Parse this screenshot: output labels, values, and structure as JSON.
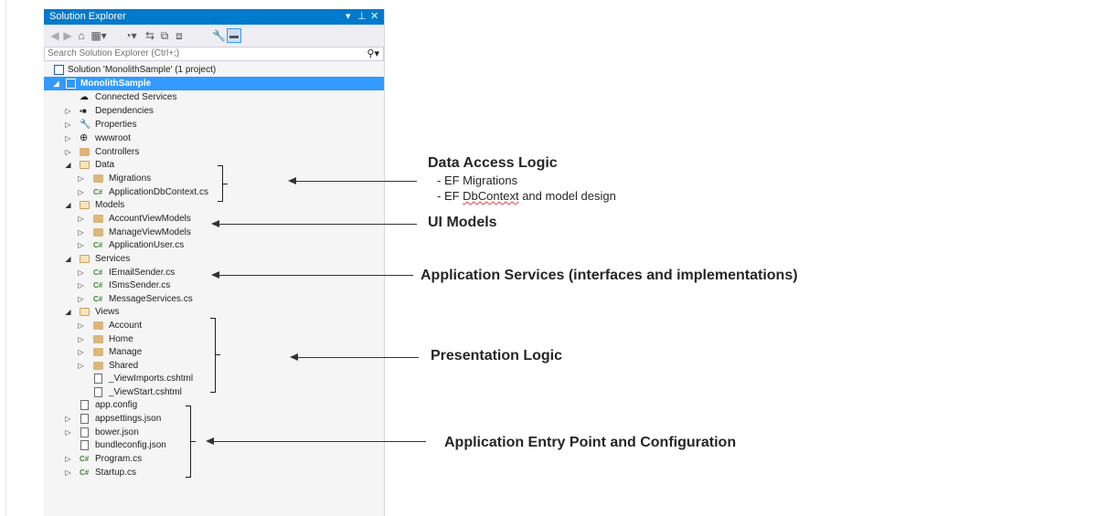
{
  "panel": {
    "title": "Solution Explorer",
    "pin_glyph": "▾ 🖈 ✕",
    "search_placeholder": "Search Solution Explorer (Ctrl+;)",
    "toolbar_icons": [
      "back-icon",
      "forward-icon",
      "home-icon",
      "switch-views-icon",
      "history-icon",
      "sync-icon",
      "collapse-all-icon",
      "show-all-files-icon",
      "properties-icon",
      "preview-icon"
    ]
  },
  "tree": [
    {
      "label": "Solution 'MonolithSample' (1 project)",
      "icon": "solution-icon"
    },
    {
      "label": "MonolithSample",
      "icon": "project-icon"
    },
    {
      "label": "Connected Services",
      "icon": "connected-services-icon"
    },
    {
      "label": "Dependencies",
      "icon": "dependencies-icon"
    },
    {
      "label": "Properties",
      "icon": "wrench-icon"
    },
    {
      "label": "wwwroot",
      "icon": "globe-icon"
    },
    {
      "label": "Controllers",
      "icon": "folder-icon"
    },
    {
      "label": "Data",
      "icon": "folder-open-icon"
    },
    {
      "label": "Migrations",
      "icon": "folder-icon"
    },
    {
      "label": "ApplicationDbContext.cs",
      "icon": "csharp-icon"
    },
    {
      "label": "Models",
      "icon": "folder-open-icon"
    },
    {
      "label": "AccountViewModels",
      "icon": "folder-icon"
    },
    {
      "label": "ManageViewModels",
      "icon": "folder-icon"
    },
    {
      "label": "ApplicationUser.cs",
      "icon": "csharp-icon"
    },
    {
      "label": "Services",
      "icon": "folder-open-icon"
    },
    {
      "label": "IEmailSender.cs",
      "icon": "csharp-icon"
    },
    {
      "label": "ISmsSender.cs",
      "icon": "csharp-icon"
    },
    {
      "label": "MessageServices.cs",
      "icon": "csharp-icon"
    },
    {
      "label": "Views",
      "icon": "folder-open-icon"
    },
    {
      "label": "Account",
      "icon": "folder-icon"
    },
    {
      "label": "Home",
      "icon": "folder-icon"
    },
    {
      "label": "Manage",
      "icon": "folder-icon"
    },
    {
      "label": "Shared",
      "icon": "folder-icon"
    },
    {
      "label": "_ViewImports.cshtml",
      "icon": "cshtml-icon"
    },
    {
      "label": "_ViewStart.cshtml",
      "icon": "cshtml-icon"
    },
    {
      "label": "app.config",
      "icon": "config-icon"
    },
    {
      "label": "appsettings.json",
      "icon": "json-icon"
    },
    {
      "label": "bower.json",
      "icon": "json-icon"
    },
    {
      "label": "bundleconfig.json",
      "icon": "json-icon"
    },
    {
      "label": "Program.cs",
      "icon": "csharp-icon"
    },
    {
      "label": "Startup.cs",
      "icon": "csharp-icon"
    }
  ],
  "annotations": {
    "data_access": {
      "title": "Data Access Logic",
      "line1": "- EF Migrations",
      "line2_prefix": "- EF ",
      "line2_word": "DbContext",
      "line2_suffix": " and model design"
    },
    "ui_models": {
      "title": "UI Models"
    },
    "app_services": {
      "title": "Application Services (interfaces and implementations)"
    },
    "presentation": {
      "title": "Presentation Logic"
    },
    "entry_point": {
      "title": "Application Entry Point and Configuration"
    }
  }
}
